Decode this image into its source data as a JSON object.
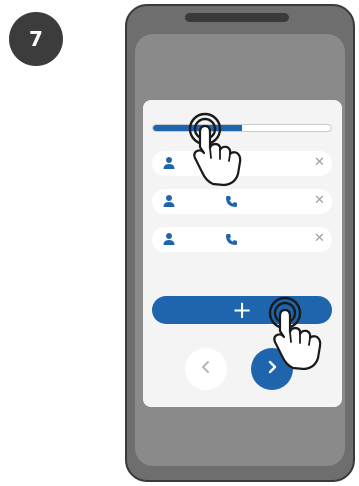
{
  "step": {
    "number": "7"
  },
  "progress": {
    "fraction": 0.5
  },
  "contacts": [
    {
      "icon": "person-icon",
      "has_phone": false,
      "remove_icon": "close-icon"
    },
    {
      "icon": "person-icon",
      "has_phone": true,
      "phone_icon": "phone-icon",
      "remove_icon": "close-icon"
    },
    {
      "icon": "person-icon",
      "has_phone": true,
      "phone_icon": "phone-icon",
      "remove_icon": "close-icon"
    }
  ],
  "add_button": {
    "label": "+"
  },
  "navigation": {
    "back_icon": "chevron-left-icon",
    "next_icon": "chevron-right-icon"
  },
  "gestures": [
    "tap-hand-icon",
    "tap-hand-icon"
  ],
  "colors": {
    "accent": "#1e65ad",
    "badge": "#3c3c3c",
    "phone_frame": "#6e6e6e",
    "card": "#f4f4f4"
  },
  "close_glyph": "✕"
}
